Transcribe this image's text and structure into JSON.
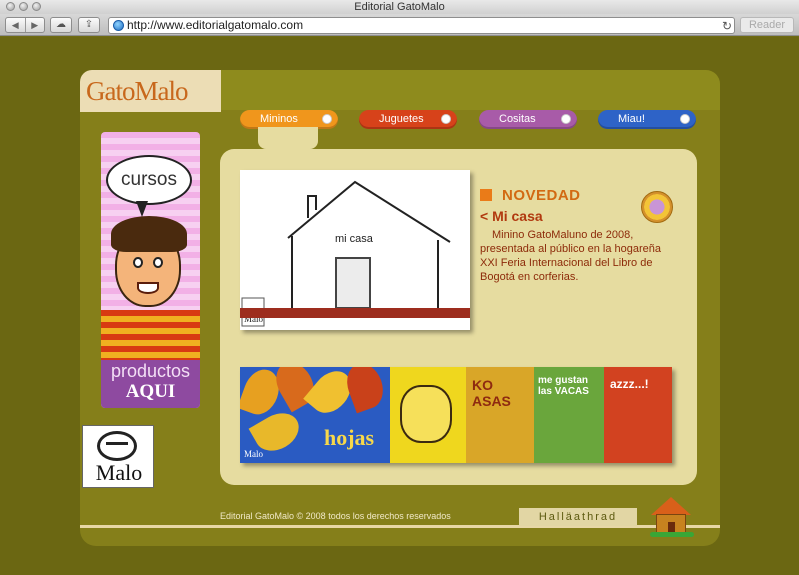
{
  "browser": {
    "title": "Editorial GatoMalo",
    "url": "http://www.editorialgatomalo.com",
    "reader_label": "Reader"
  },
  "site": {
    "logo": "GatoMalo",
    "tabs": [
      {
        "label": "Mininos",
        "color": "#f0961c"
      },
      {
        "label": "Juguetes",
        "color": "#d7421a"
      },
      {
        "label": "Cositas",
        "color": "#a85ba8"
      },
      {
        "label": "Miau!",
        "color": "#2e63c7"
      }
    ],
    "promo": {
      "bubble": "cursos",
      "label_line1": "productos",
      "label_line2": "AQUI"
    },
    "malo_logo": "Malo",
    "feature": {
      "house_label": "mi casa",
      "publisher_mark": "Malo"
    },
    "news": {
      "heading": "NOVEDAD",
      "title": "< Mi casa",
      "body": "Minino GatoMaluno de 2008, presentada al público en la hogareña XXI Feria Internacional del Libro de Bogotá en corferias."
    },
    "books": {
      "b1_title": "hojas",
      "b1_mark": "Malo",
      "b3_title": "KO ASAS",
      "b4_title": "me gustan las VACAS",
      "b5_title": "azzz...!"
    },
    "footer": {
      "copyright": "Editorial GatoMalo © 2008 todos los derechos reservados",
      "button": "Halläathrad"
    }
  }
}
